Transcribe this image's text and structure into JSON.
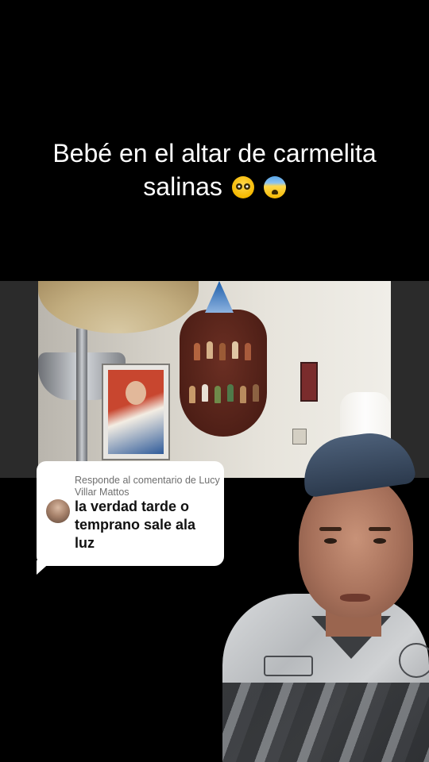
{
  "caption": {
    "line1": "Bebé en el altar de carmelita",
    "line2": "salinas",
    "emojis": [
      "flushed-face-emoji",
      "fearful-face-emoji"
    ]
  },
  "reply": {
    "header": "Responde al comentario de Lucy Villar Mattos",
    "comment": "la verdad tarde o temprano sale ala luz"
  },
  "colors": {
    "background": "#000000",
    "bubble": "#ffffff",
    "caption_text": "#ffffff",
    "reply_header_text": "#6e6e6e",
    "reply_text": "#111111"
  }
}
